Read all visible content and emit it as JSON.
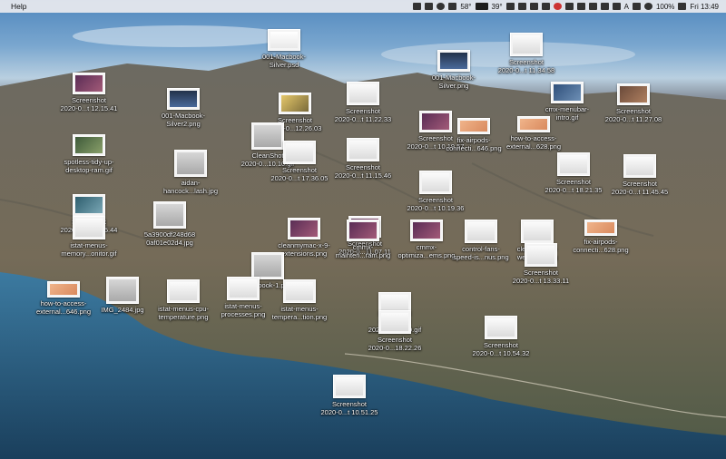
{
  "menubar": {
    "app_menu": "Help",
    "cpu_temp": "58°",
    "temp_badge": "39°",
    "battery": "100%",
    "clock": "Fri 13:49",
    "input_source": "A"
  },
  "desktop_files": [
    {
      "label": "001-Macbook-\nSilver.psd",
      "thumb": "white-mac"
    },
    {
      "label": "Screenshot\n2020-0...t 11.34.58",
      "thumb": "doc-light"
    },
    {
      "label": "001-Macbook-\nSilver.png",
      "thumb": "dark-mac"
    },
    {
      "label": "Screenshot\n2020-0...t 12.15.41",
      "thumb": "photo-purple"
    },
    {
      "label": "001-Macbook-\nSilver2.png",
      "thumb": "dark-mac"
    },
    {
      "label": "Screenshot\n2020-0...12.26.03",
      "thumb": "photo-yellow"
    },
    {
      "label": "Screenshot\n2020-0...t 11.22.33",
      "thumb": "doc-light"
    },
    {
      "label": "cmx-menubar-\nintro.gif",
      "thumb": "photo-blue"
    },
    {
      "label": "Screenshot\n2020-0...t 11.27.08",
      "thumb": "photo-brown"
    },
    {
      "label": "Screenshot\n2020-0...t 10.19.57",
      "thumb": "photo-purple"
    },
    {
      "label": "fix-airpods-\nconnecti...646.png",
      "thumb": "photo-peach"
    },
    {
      "label": "how-to-access-\nexternal...628.png",
      "thumb": "photo-peach"
    },
    {
      "label": "spotless-tidy-up-\ndesktop-ram.gif",
      "thumb": "photo-green"
    },
    {
      "label": "CleanShot\n2020-0...10.10.gif",
      "thumb": "doc-grey"
    },
    {
      "label": "Screenshot\n2020-0...t 17.36.05",
      "thumb": "doc-light"
    },
    {
      "label": "Screenshot\n2020-0...t 11.15.46",
      "thumb": "doc-light"
    },
    {
      "label": "aidan-\nhancock...lash.jpg",
      "thumb": "doc-grey"
    },
    {
      "label": "Screenshot\n2020-0...t 18.21.35",
      "thumb": "doc-light"
    },
    {
      "label": "Screenshot\n2020-0...t 11.45.45",
      "thumb": "doc-light"
    },
    {
      "label": "Screenshot\n2020-0...t 10.19.36",
      "thumb": "doc-light"
    },
    {
      "label": "5a3900df248d68\n0af01e02d4.jpg",
      "thumb": "doc-grey"
    },
    {
      "label": "Screenshot\n2020-0...t 12.05.44",
      "thumb": "photo-teal"
    },
    {
      "label": "istat-menus-\nmemory...onitor.gif",
      "thumb": "doc-light"
    },
    {
      "label": "Screenshot\n2020-0...11.07.11",
      "thumb": "photo-purple"
    },
    {
      "label": "cleanmymac-x-9-\nextensions.png",
      "thumb": "photo-purple"
    },
    {
      "label": "cmmx-\nmainten...ram.png",
      "thumb": "photo-purple"
    },
    {
      "label": "cmmx-\noptimiza...ems.png",
      "thumb": "photo-purple"
    },
    {
      "label": "control-fans-\nspeed-is...nus.png",
      "thumb": "doc-light"
    },
    {
      "label": "cleanmymac-\nwelcome.png",
      "thumb": "doc-light"
    },
    {
      "label": "fix-airpods-\nconnecti...628.png",
      "thumb": "photo-peach"
    },
    {
      "label": "Notebook-1.psd",
      "thumb": "doc-grey"
    },
    {
      "label": "Screenshot\n2020-0...t 13.33.11",
      "thumb": "doc-light"
    },
    {
      "label": "how-to-access-\nexternal...646.png",
      "thumb": "photo-peach"
    },
    {
      "label": "IMG_2484.jpg",
      "thumb": "doc-grey"
    },
    {
      "label": "istat-menus-cpu-\ntemperature.png",
      "thumb": "doc-light"
    },
    {
      "label": "istat-menus-\nprocesses.png",
      "thumb": "doc-light"
    },
    {
      "label": "istat-menus-\ntempera...tion.png",
      "thumb": "doc-light"
    },
    {
      "label": "CleanShot\n2020-0...53.29.gif",
      "thumb": "doc-light"
    },
    {
      "label": "Screenshot\n2020-0...18.22.26",
      "thumb": "doc-light"
    },
    {
      "label": "Screenshot\n2020-0...t 10.54.32",
      "thumb": "doc-light"
    },
    {
      "label": "Screenshot\n2020-0...t 10.51.25",
      "thumb": "doc-light"
    }
  ]
}
